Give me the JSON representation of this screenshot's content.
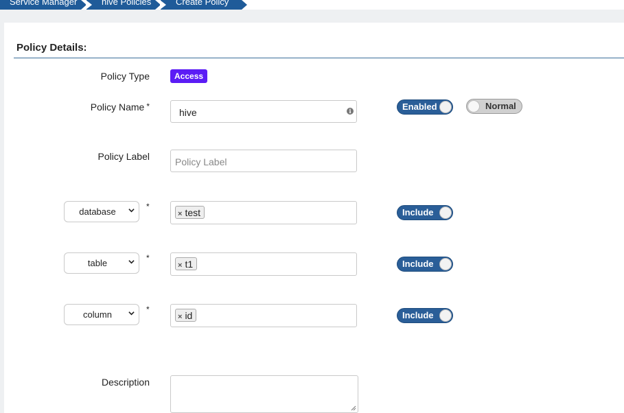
{
  "breadcrumb": [
    "Service Manager",
    "hive Policies",
    "Create Policy"
  ],
  "section_title": "Policy Details:",
  "policy_type": {
    "label": "Policy Type",
    "badge": "Access"
  },
  "policy_name": {
    "label": "Policy Name",
    "required": "*",
    "value": "hive",
    "info_icon": "info-icon"
  },
  "policy_label": {
    "label": "Policy Label",
    "placeholder": "Policy Label"
  },
  "toggles": {
    "enabled": "Enabled",
    "normal": "Normal"
  },
  "resources": [
    {
      "select": "database",
      "required": "*",
      "tag": "test",
      "toggle": "Include"
    },
    {
      "select": "table",
      "required": "*",
      "tag": "t1",
      "toggle": "Include"
    },
    {
      "select": "column",
      "required": "*",
      "tag": "id",
      "toggle": "Include"
    }
  ],
  "description": {
    "label": "Description",
    "value": ""
  },
  "colors": {
    "crumb": "#1f5b99",
    "badge": "#5b1cf5",
    "toggle_on": "#2a5e98"
  }
}
